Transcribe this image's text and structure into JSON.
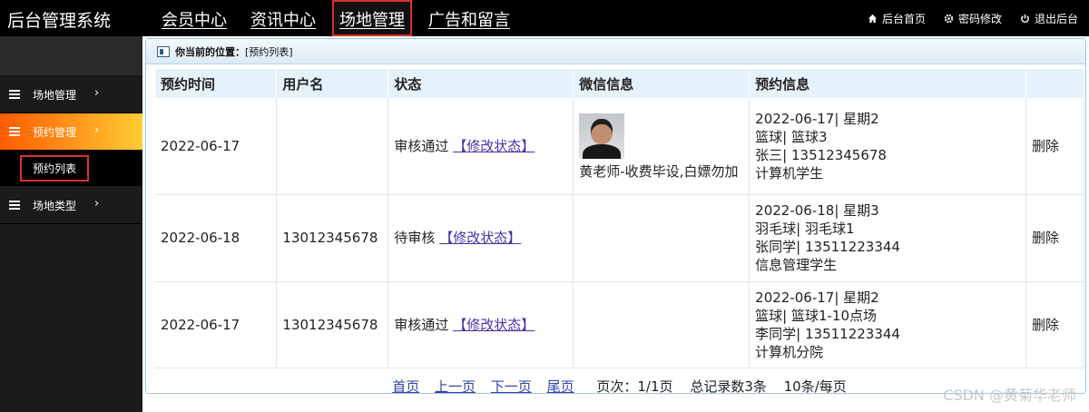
{
  "app": {
    "title": "后台管理系统"
  },
  "nav": [
    {
      "label": "会员中心"
    },
    {
      "label": "资讯中心"
    },
    {
      "label": "场地管理"
    },
    {
      "label": "广告和留言"
    }
  ],
  "top_links": [
    {
      "label": "后台首页",
      "icon": "home-icon"
    },
    {
      "label": "密码修改",
      "icon": "gear-icon"
    },
    {
      "label": "退出后台",
      "icon": "power-icon"
    }
  ],
  "sidebar": {
    "items": [
      {
        "label": "场地管理",
        "chev": "›"
      },
      {
        "label": "预约管理",
        "chev": "›"
      },
      {
        "label": "场地类型",
        "chev": "›"
      }
    ],
    "sub_item": "预约列表"
  },
  "crumb": {
    "label": "你当前的位置：",
    "value": "[预约列表]"
  },
  "table": {
    "headers": [
      "预约时间",
      "用户名",
      "状态",
      "微信信息",
      "预约信息",
      ""
    ],
    "rows": [
      {
        "time": "2022-06-17",
        "user": "",
        "status": "审核通过",
        "edit": "【修改状态】",
        "wx_name": "黄老师-收费毕设,白嫖勿加",
        "info": [
          "2022-06-17| 星期2",
          "篮球| 篮球3",
          "张三| 13512345678",
          "计算机学生"
        ],
        "op": "删除"
      },
      {
        "time": "2022-06-18",
        "user": "13012345678",
        "status": "待审核",
        "edit": "【修改状态】",
        "wx_name": "",
        "info": [
          "2022-06-18| 星期3",
          "羽毛球| 羽毛球1",
          "张同学| 13511223344",
          "信息管理学生"
        ],
        "op": "删除"
      },
      {
        "time": "2022-06-17",
        "user": "13012345678",
        "status": "审核通过",
        "edit": "【修改状态】",
        "wx_name": "",
        "info": [
          "2022-06-17| 星期2",
          "篮球| 篮球1-10点场",
          "李同学| 13511223344",
          "计算机分院"
        ],
        "op": "删除"
      }
    ]
  },
  "pager": {
    "first": "首页",
    "prev": "上一页",
    "next": "下一页",
    "last": "尾页",
    "page_info": "页次：1/1页",
    "total": "总记录数3条",
    "per_page": "10条/每页"
  },
  "watermark": "CSDN @黄菊华老师"
}
